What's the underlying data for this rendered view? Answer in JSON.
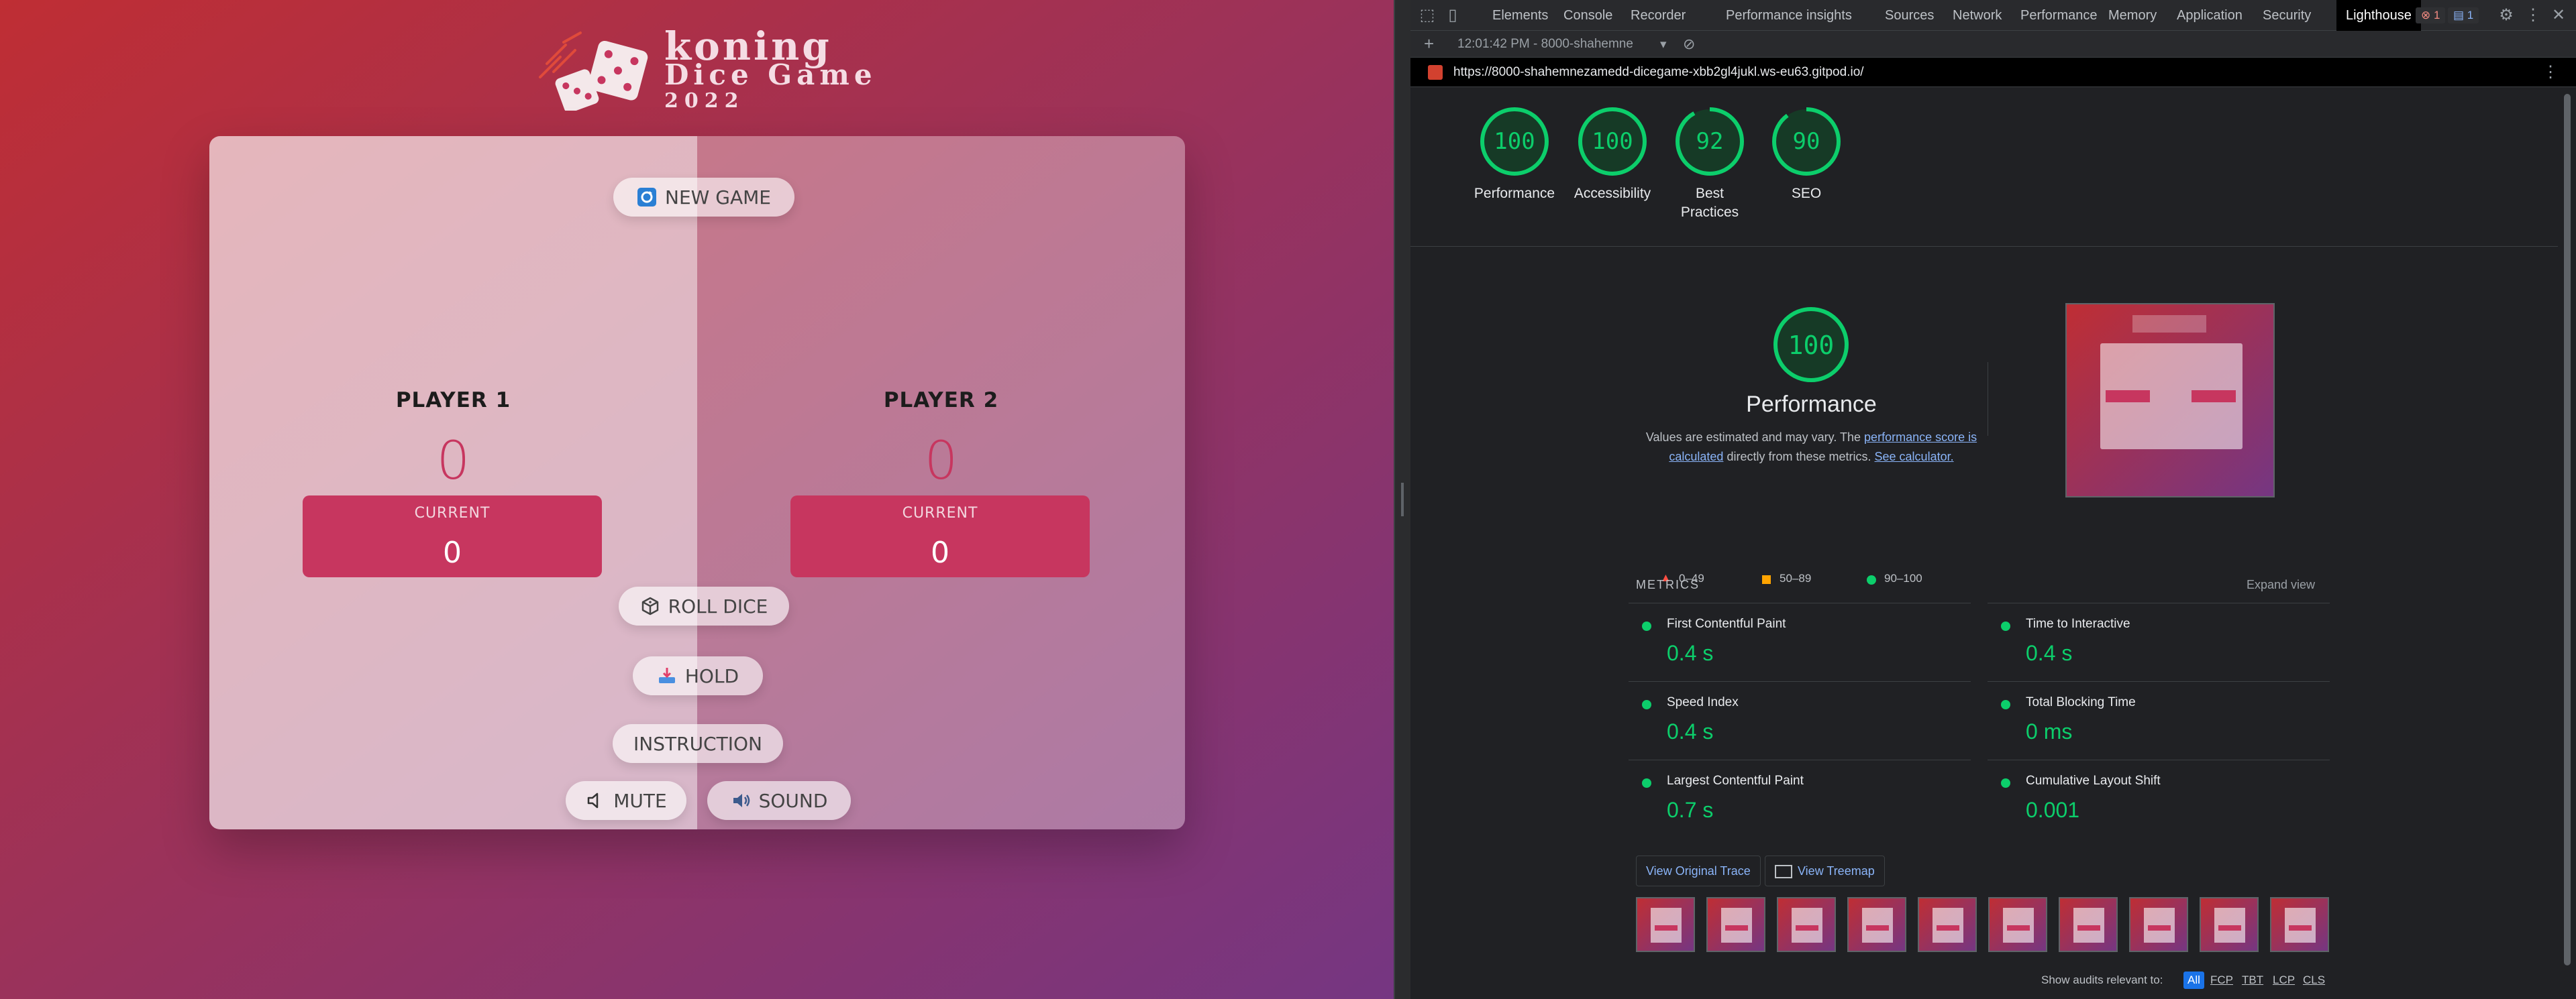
{
  "game": {
    "logo": {
      "line1": "koning",
      "line2": "Dice Game",
      "line3": "2022"
    },
    "new_game_label": "NEW GAME",
    "players": [
      {
        "name": "PLAYER 1",
        "score": "0",
        "current_label": "CURRENT",
        "current_score": "0"
      },
      {
        "name": "PLAYER 2",
        "score": "0",
        "current_label": "CURRENT",
        "current_score": "0"
      }
    ],
    "roll_label": "ROLL DICE",
    "hold_label": "HOLD",
    "instruction_label": "INSTRUCTION",
    "mute_label": "MUTE",
    "sound_label": "SOUND",
    "colors": {
      "accent": "#c7365f",
      "bg_start": "#bf2e34",
      "bg_end": "#753682"
    }
  },
  "devtools": {
    "tabs": [
      "Elements",
      "Console",
      "Recorder",
      "Performance insights",
      "Sources",
      "Network",
      "Performance",
      "Memory",
      "Application",
      "Security",
      "Lighthouse"
    ],
    "active_tab": "Lighthouse",
    "error_count": "1",
    "message_count": "1",
    "toolbar_time": "12:01:42 PM - 8000-shahemne",
    "url": "https://8000-shahemnezamedd-dicegame-xbb2gl4jukl.ws-eu63.gitpod.io/",
    "scores": [
      {
        "label": "Performance",
        "value": "100"
      },
      {
        "label": "Accessibility",
        "value": "100"
      },
      {
        "label": "Best Practices",
        "value": "92"
      },
      {
        "label": "SEO",
        "value": "90"
      }
    ],
    "performance": {
      "score": "100",
      "title": "Performance",
      "desc_prefix": "Values are estimated and may vary. The ",
      "link1": "performance score is calculated",
      "desc_mid": " directly from these metrics. ",
      "link2": "See calculator.",
      "legend": [
        "0–49",
        "50–89",
        "90–100"
      ]
    },
    "metrics_title": "METRICS",
    "expand_label": "Expand view",
    "metrics": [
      {
        "name": "First Contentful Paint",
        "value": "0.4 s"
      },
      {
        "name": "Time to Interactive",
        "value": "0.4 s"
      },
      {
        "name": "Speed Index",
        "value": "0.4 s"
      },
      {
        "name": "Total Blocking Time",
        "value": "0 ms"
      },
      {
        "name": "Largest Contentful Paint",
        "value": "0.7 s"
      },
      {
        "name": "Cumulative Layout Shift",
        "value": "0.001"
      }
    ],
    "view_trace_label": "View Original Trace",
    "view_treemap_label": "View Treemap",
    "audits_label": "Show audits relevant to:",
    "audit_filters": [
      "All",
      "FCP",
      "TBT",
      "LCP",
      "CLS"
    ],
    "colors": {
      "pass": "#0cce6b",
      "average": "#ffa400",
      "fail": "#ff4e42",
      "link": "#8ab4f8"
    }
  }
}
